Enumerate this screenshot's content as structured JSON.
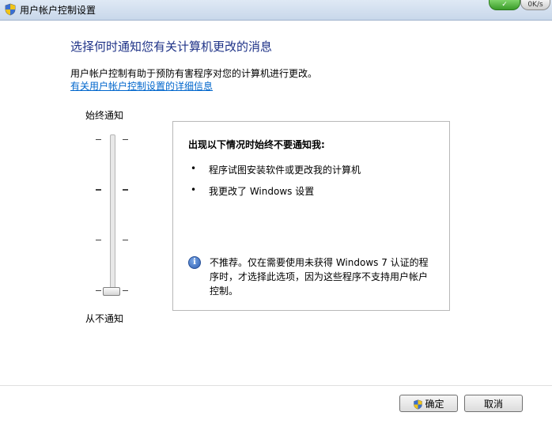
{
  "window": {
    "title": "用户帐户控制设置",
    "icon": "uac-shield-icon"
  },
  "titlebar": {
    "green_button_label": "",
    "gray_button_label": "0K/s"
  },
  "main": {
    "heading": "选择何时通知您有关计算机更改的消息",
    "description": "用户帐户控制有助于预防有害程序对您的计算机进行更改。",
    "link": "有关用户帐户控制设置的详细信息"
  },
  "slider": {
    "top_label": "始终通知",
    "bottom_label": "从不通知",
    "levels": 4,
    "selected_level": 1
  },
  "info": {
    "heading": "出现以下情况时始终不要通知我:",
    "bullets": [
      "程序试图安装软件或更改我的计算机",
      "我更改了 Windows 设置"
    ],
    "bullet_symbol": "•",
    "note_icon": "info-icon",
    "note": "不推荐。仅在需要使用未获得 Windows 7 认证的程序时，才选择此选项，因为这些程序不支持用户帐户控制。"
  },
  "buttons": {
    "ok": "确定",
    "cancel": "取消"
  },
  "colors": {
    "heading": "#1e3287",
    "link": "#0066cc"
  }
}
